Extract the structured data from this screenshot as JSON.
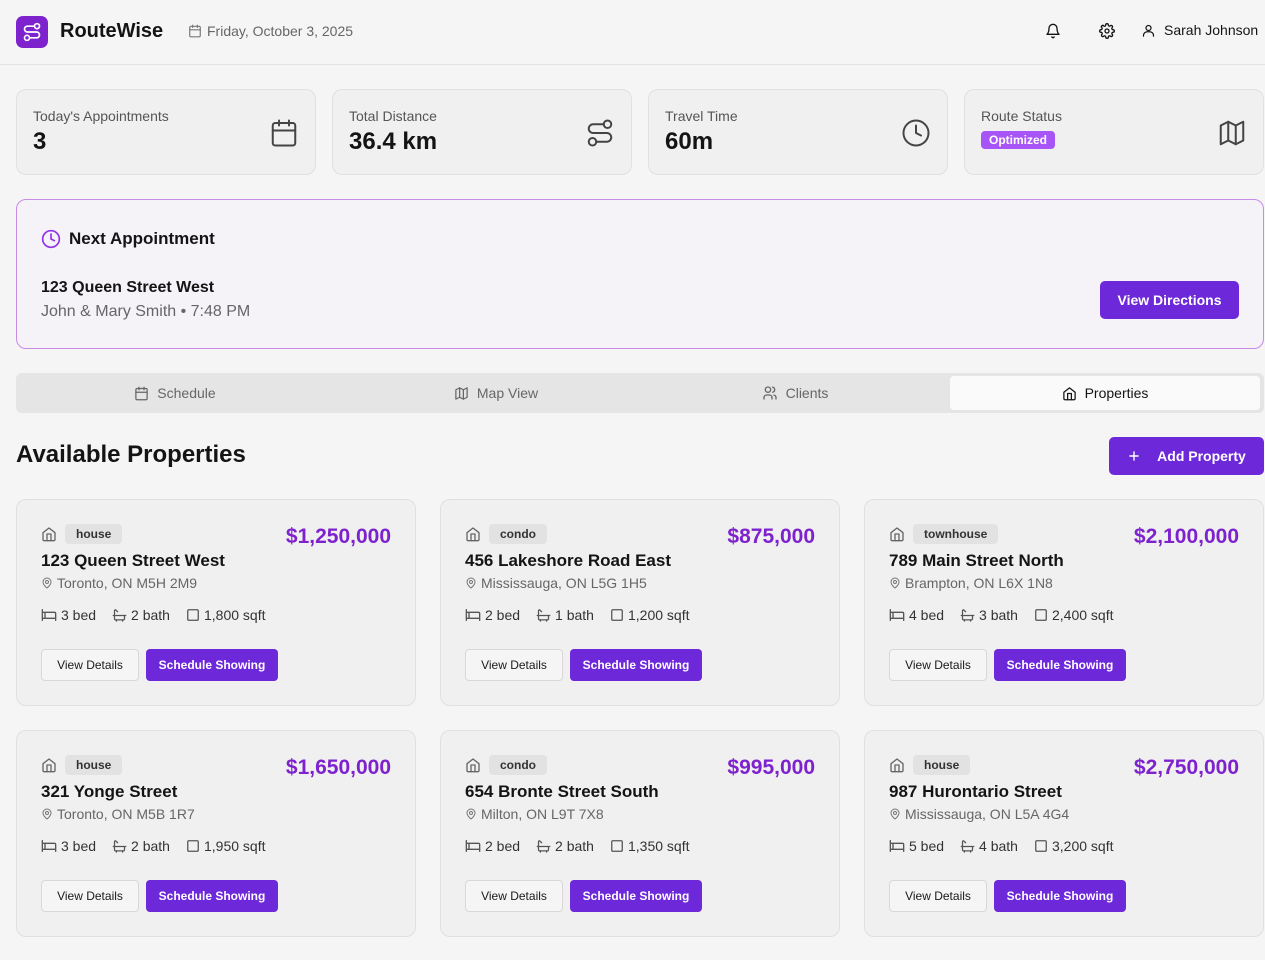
{
  "header": {
    "app_name": "RouteWise",
    "date": "Friday, October 3, 2025",
    "user_name": "Sarah Johnson",
    "icons": [
      "route-icon",
      "calendar-icon",
      "bell-icon",
      "gear-icon",
      "user-icon"
    ]
  },
  "stats": [
    {
      "label": "Today's Appointments",
      "value": "3",
      "icon": "calendar-icon"
    },
    {
      "label": "Total Distance",
      "value": "36.4 km",
      "icon": "route-icon"
    },
    {
      "label": "Travel Time",
      "value": "60m",
      "icon": "clock-icon"
    },
    {
      "label": "Route Status",
      "badge": "Optimized",
      "icon": "map-icon"
    }
  ],
  "next_appointment": {
    "title": "Next Appointment",
    "address": "123 Queen Street West",
    "meta": "John & Mary Smith • 7:48 PM",
    "button_label": "View Directions"
  },
  "tabs": [
    {
      "label": "Schedule",
      "icon": "calendar-icon",
      "active": false
    },
    {
      "label": "Map View",
      "icon": "map-icon",
      "active": false
    },
    {
      "label": "Clients",
      "icon": "users-icon",
      "active": false
    },
    {
      "label": "Properties",
      "icon": "home-icon",
      "active": true
    }
  ],
  "section": {
    "title": "Available Properties",
    "add_button_label": "Add Property"
  },
  "properties": [
    {
      "type": "house",
      "price": "$1,250,000",
      "address": "123 Queen Street West",
      "city": "Toronto, ON M5H 2M9",
      "beds": "3 bed",
      "baths": "2 bath",
      "sqft": "1,800 sqft",
      "view_label": "View Details",
      "schedule_label": "Schedule Showing"
    },
    {
      "type": "condo",
      "price": "$875,000",
      "address": "456 Lakeshore Road East",
      "city": "Mississauga, ON L5G 1H5",
      "beds": "2 bed",
      "baths": "1 bath",
      "sqft": "1,200 sqft",
      "view_label": "View Details",
      "schedule_label": "Schedule Showing"
    },
    {
      "type": "townhouse",
      "price": "$2,100,000",
      "address": "789 Main Street North",
      "city": "Brampton, ON L6X 1N8",
      "beds": "4 bed",
      "baths": "3 bath",
      "sqft": "2,400 sqft",
      "view_label": "View Details",
      "schedule_label": "Schedule Showing"
    },
    {
      "type": "house",
      "price": "$1,650,000",
      "address": "321 Yonge Street",
      "city": "Toronto, ON M5B 1R7",
      "beds": "3 bed",
      "baths": "2 bath",
      "sqft": "1,950 sqft",
      "view_label": "View Details",
      "schedule_label": "Schedule Showing"
    },
    {
      "type": "condo",
      "price": "$995,000",
      "address": "654 Bronte Street South",
      "city": "Milton, ON L9T 7X8",
      "beds": "2 bed",
      "baths": "2 bath",
      "sqft": "1,350 sqft",
      "view_label": "View Details",
      "schedule_label": "Schedule Showing"
    },
    {
      "type": "house",
      "price": "$2,750,000",
      "address": "987 Hurontario Street",
      "city": "Mississauga, ON L5A 4G4",
      "beds": "5 bed",
      "baths": "4 bath",
      "sqft": "3,200 sqft",
      "view_label": "View Details",
      "schedule_label": "Schedule Showing"
    }
  ],
  "colors": {
    "brand": "#7e22ce",
    "button": "#6d28d9",
    "badge": "#a855f7",
    "highlight_border": "#c98be8"
  }
}
